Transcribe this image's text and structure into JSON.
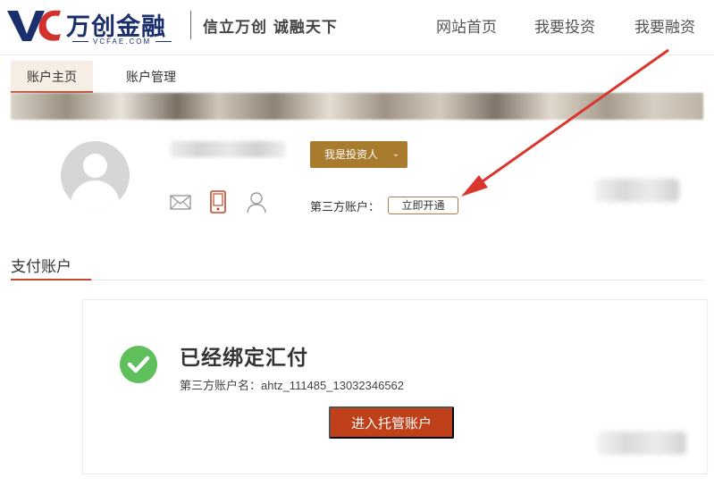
{
  "header": {
    "logo_name": "万创金融",
    "logo_domain": "VCFAE.COM",
    "slogan": "信立万创 诚融天下",
    "nav": {
      "home": "网站首页",
      "invest": "我要投资",
      "finance": "我要融资"
    }
  },
  "tabs": {
    "account_home": "账户主页",
    "account_manage": "账户管理"
  },
  "profile": {
    "role_button": "我是投资人",
    "role_caret": "⌄",
    "third_party_label": "第三方账户：",
    "open_now_button": "立即开通",
    "icons": [
      "mail-icon",
      "phone-icon",
      "user-icon"
    ]
  },
  "section": {
    "title": "支付账户"
  },
  "bound_card": {
    "title": "已经绑定汇付",
    "account_line": "第三方账户名：ahtz_111485_13032346562",
    "enter_button": "进入托管账户"
  },
  "colors": {
    "brand_blue": "#1a2f6b",
    "brand_red": "#d2322d",
    "accent": "#c0492b",
    "gold_button": "#a87b2f",
    "success_green": "#5fbf5a",
    "enter_button_bg": "#c0401a"
  }
}
